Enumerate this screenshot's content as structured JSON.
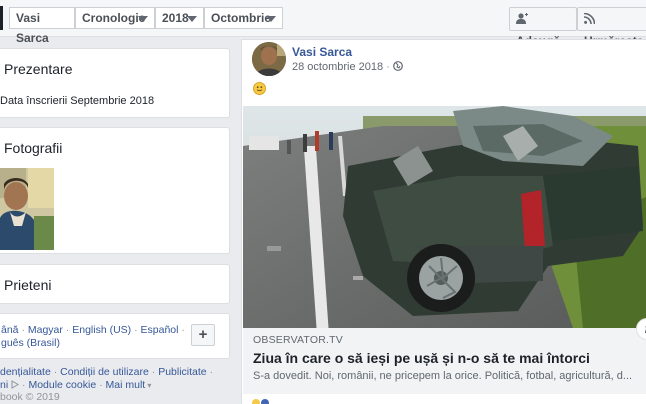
{
  "topbar": {
    "name": "Vasi Sarca",
    "section": "Cronologie",
    "year": "2018",
    "month": "Octombrie",
    "add_label": "Adaugă",
    "follow_label": "Urmărește"
  },
  "intro": {
    "title": "Prezentare",
    "joined": "Data înscrierii Septembrie 2018"
  },
  "photos": {
    "title": "Fotografii"
  },
  "friends": {
    "title": "Prieteni"
  },
  "languages": {
    "items": [
      "ână",
      "Magyar",
      "English (US)",
      "Español"
    ],
    "line2": "guês (Brasil)",
    "plus": "+"
  },
  "footer": {
    "line1": [
      "dențialitate",
      "Condiții de utilizare",
      "Publicitate"
    ],
    "line2_a": "ni",
    "line2_b": "Module cookie",
    "line2_c": "Mai mult",
    "copyright": "book © 2019"
  },
  "post": {
    "author": "Vasi Sarca",
    "date": "28 octombrie 2018",
    "link_domain": "OBSERVATOR.TV",
    "link_title": "Ziua în care o să ieși pe ușă și n-o să te mai întorci",
    "link_desc": "S-a dovedit. Noi, românii, ne pricepem la orice. Politică, fotbal, agricultură, d...",
    "info_label": "i"
  },
  "colors": {
    "link": "#365899",
    "bg": "#e9ebee",
    "accent": "#4267b2"
  }
}
